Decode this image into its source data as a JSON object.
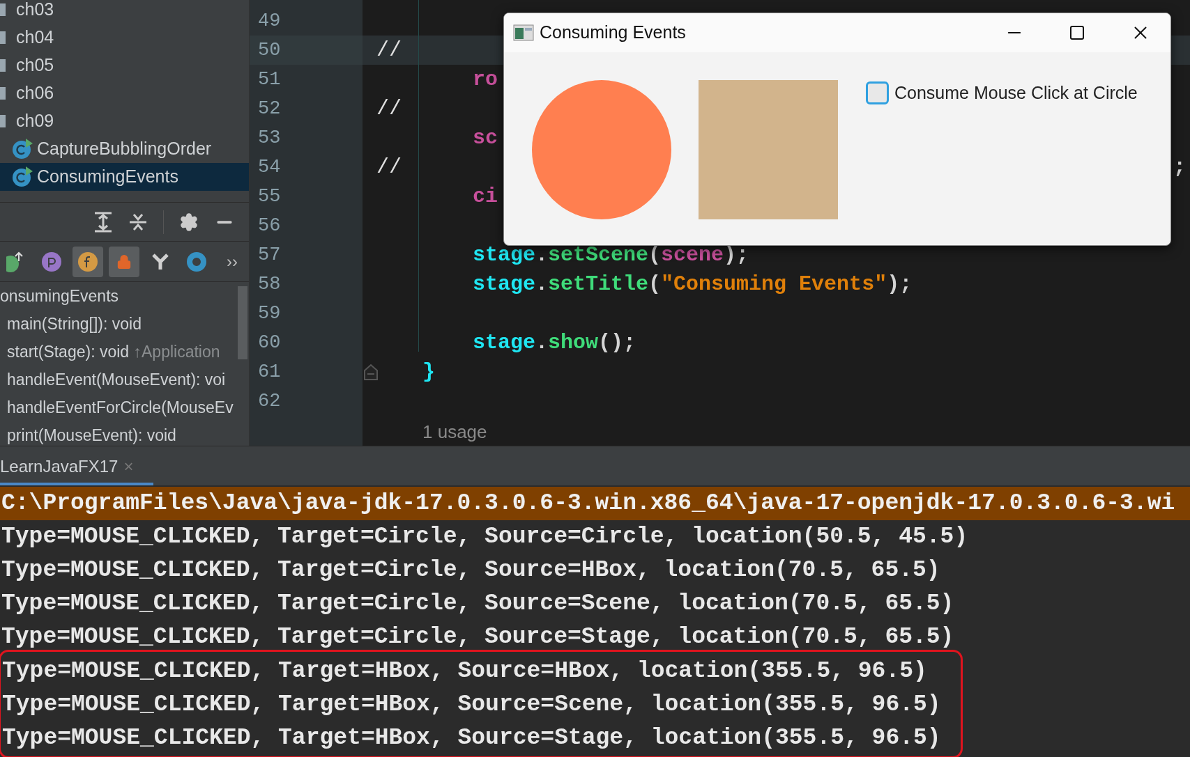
{
  "project_tree": [
    {
      "label": "ch03",
      "kind": "folder",
      "selected": false
    },
    {
      "label": "ch04",
      "kind": "folder",
      "selected": false
    },
    {
      "label": "ch05",
      "kind": "folder",
      "selected": false
    },
    {
      "label": "ch06",
      "kind": "folder",
      "selected": false
    },
    {
      "label": "ch09",
      "kind": "folder",
      "selected": false
    },
    {
      "label": "CaptureBubblingOrder",
      "kind": "class",
      "selected": false
    },
    {
      "label": "ConsumingEvents",
      "kind": "class",
      "selected": true
    }
  ],
  "structure_toolbar": [
    {
      "kind": "inherited",
      "selected": false
    },
    {
      "kind": "properties",
      "selected": false
    },
    {
      "kind": "fields",
      "selected": true
    },
    {
      "kind": "nonpublic",
      "selected": true
    },
    {
      "kind": "anonymous",
      "selected": false
    },
    {
      "kind": "lambdas",
      "selected": false
    },
    {
      "kind": "more",
      "label": "››",
      "selected": false
    }
  ],
  "structure": [
    {
      "label": "onsumingEvents",
      "kind": "class"
    },
    {
      "label": "main(String[]): void",
      "kind": "member"
    },
    {
      "label": "start(Stage): void",
      "kind": "member",
      "note": "↑Application"
    },
    {
      "label": "handleEvent(MouseEvent): voi",
      "kind": "member"
    },
    {
      "label": "handleEventForCircle(MouseEv",
      "kind": "member"
    },
    {
      "label": "print(MouseEvent): void",
      "kind": "member"
    }
  ],
  "editor": {
    "lines": [
      {
        "number": "49",
        "current": false
      },
      {
        "number": "50",
        "current": true,
        "comment": "//"
      },
      {
        "number": "51",
        "current": false,
        "tokens": [
          {
            "text": "ro",
            "kind": "var"
          }
        ]
      },
      {
        "number": "52",
        "current": false,
        "comment": "//"
      },
      {
        "number": "53",
        "current": false,
        "tokens": [
          {
            "text": "sc",
            "kind": "var"
          }
        ]
      },
      {
        "number": "54",
        "current": false,
        "comment": "//",
        "trailing": ";"
      },
      {
        "number": "55",
        "current": false,
        "tokens": [
          {
            "text": "ci",
            "kind": "var"
          }
        ]
      },
      {
        "number": "56",
        "current": false
      },
      {
        "number": "57",
        "current": false,
        "tokens": [
          {
            "text": "stage",
            "kind": "object"
          },
          {
            "text": ".",
            "kind": "plain"
          },
          {
            "text": "setScene",
            "kind": "method"
          },
          {
            "text": "(",
            "kind": "plain"
          },
          {
            "text": "scene",
            "kind": "var"
          },
          {
            "text": ");",
            "kind": "plain"
          }
        ]
      },
      {
        "number": "58",
        "current": false,
        "tokens": [
          {
            "text": "stage",
            "kind": "object"
          },
          {
            "text": ".",
            "kind": "plain"
          },
          {
            "text": "setTitle",
            "kind": "method"
          },
          {
            "text": "(",
            "kind": "plain"
          },
          {
            "text": "\"Consuming Events\"",
            "kind": "string"
          },
          {
            "text": ");",
            "kind": "plain"
          }
        ]
      },
      {
        "number": "59",
        "current": false
      },
      {
        "number": "60",
        "current": false,
        "tokens": [
          {
            "text": "stage",
            "kind": "object"
          },
          {
            "text": ".",
            "kind": "plain"
          },
          {
            "text": "show",
            "kind": "method"
          },
          {
            "text": "();",
            "kind": "plain"
          }
        ]
      },
      {
        "number": "61",
        "current": false,
        "fold": true,
        "tokens": [
          {
            "text": "}",
            "kind": "object"
          }
        ]
      },
      {
        "number": "62",
        "current": false
      }
    ],
    "usage_hint": "1 usage"
  },
  "run_tab": {
    "label": "LearnJavaFX17",
    "close": "×"
  },
  "console": [
    {
      "text": "C:\\ProgramFiles\\Java\\java-jdk-17.0.3.0.6-3.win.x86_64\\java-17-openjdk-17.0.3.0.6-3.wi",
      "kind": "command",
      "highlighted": false
    },
    {
      "text": "Type=MOUSE_CLICKED, Target=Circle, Source=Circle, location(50.5, 45.5)",
      "kind": "output",
      "highlighted": false
    },
    {
      "text": "Type=MOUSE_CLICKED, Target=Circle, Source=HBox, location(70.5, 65.5)",
      "kind": "output",
      "highlighted": false
    },
    {
      "text": "Type=MOUSE_CLICKED, Target=Circle, Source=Scene, location(70.5, 65.5)",
      "kind": "output",
      "highlighted": false
    },
    {
      "text": "Type=MOUSE_CLICKED, Target=Circle, Source=Stage, location(70.5, 65.5)",
      "kind": "output",
      "highlighted": false
    },
    {
      "text": "Type=MOUSE_CLICKED, Target=HBox, Source=HBox, location(355.5, 96.5)",
      "kind": "output",
      "highlighted": true
    },
    {
      "text": "Type=MOUSE_CLICKED, Target=HBox, Source=Scene, location(355.5, 96.5)",
      "kind": "output",
      "highlighted": true
    },
    {
      "text": "Type=MOUSE_CLICKED, Target=HBox, Source=Stage, location(355.5, 96.5)",
      "kind": "output",
      "highlighted": true
    }
  ],
  "dialog": {
    "title": "Consuming Events",
    "shapes": [
      {
        "kind": "circle",
        "color": "#ff7f50"
      },
      {
        "kind": "rectangle",
        "color": "#d2b48c"
      }
    ],
    "checkbox": {
      "label": "Consume Mouse Click at Circle",
      "checked": false
    }
  }
}
